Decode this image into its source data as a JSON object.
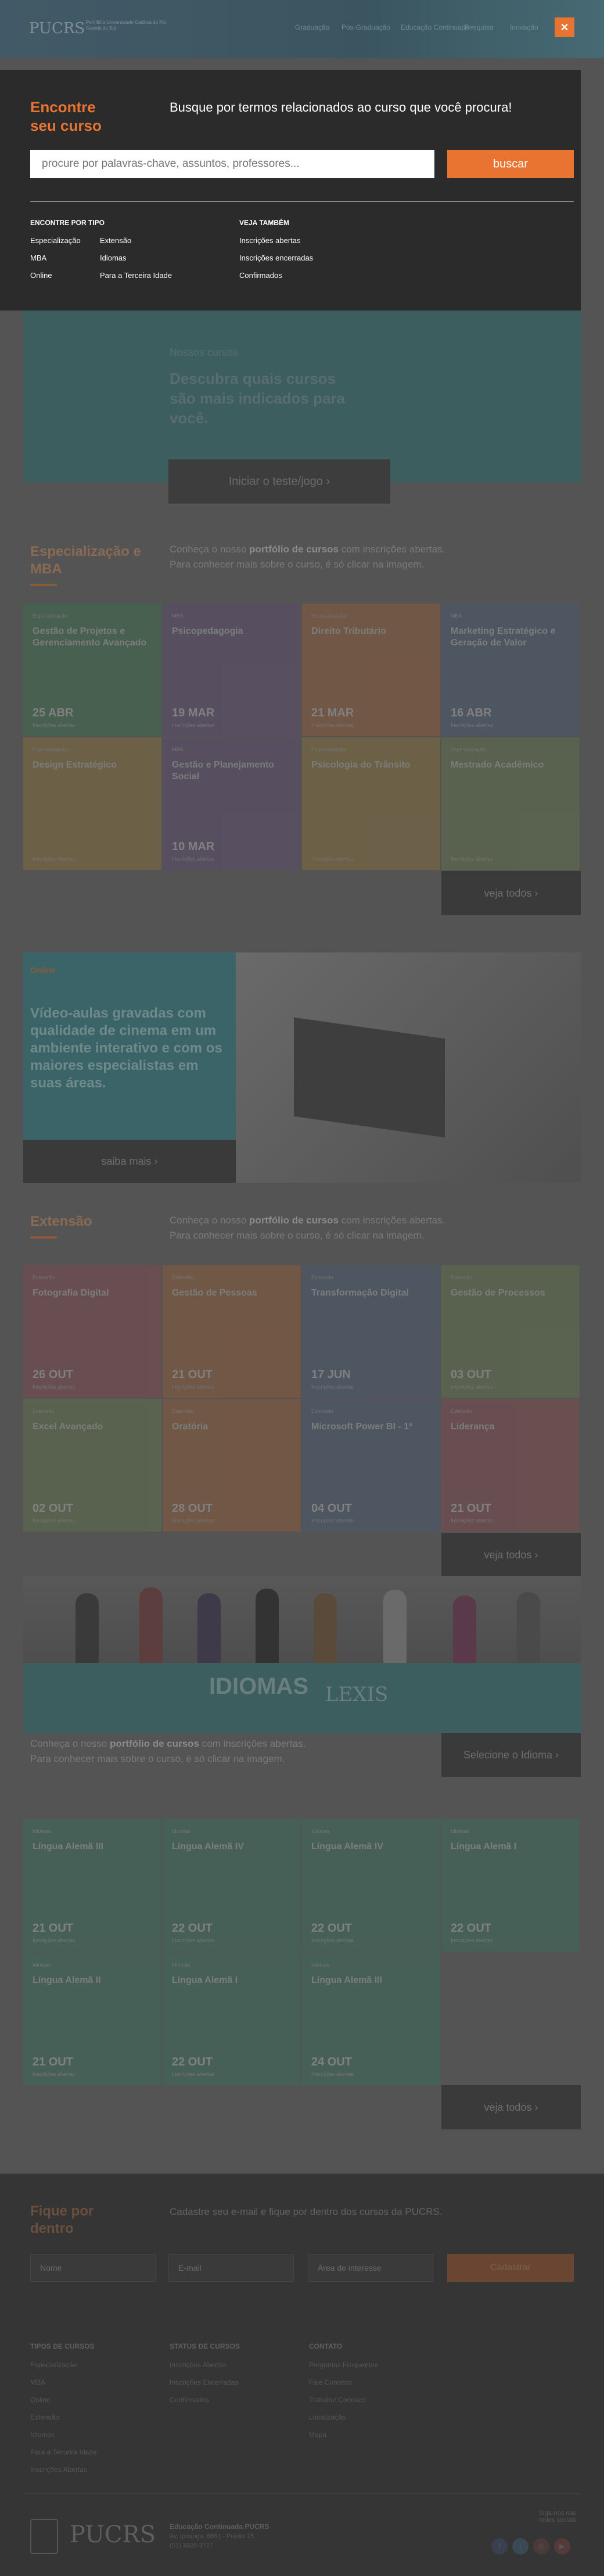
{
  "header": {
    "logo": "PUCRS",
    "logo_sub": "Pontifícia Universidade Católica do Rio Grande do Sul",
    "nav": [
      "Graduação",
      "Pós-Graduação",
      "Educação Continuada",
      "Pesquisa",
      "Inovação"
    ],
    "close_label": "×"
  },
  "search_modal": {
    "title": "Encontre seu curso",
    "subtitle": "Busque por termos relacionados ao curso que você procura!",
    "placeholder": "procure por palavras-chave, assuntos, professores...",
    "button": "buscar",
    "by_type_heading": "ENCONTRE POR TIPO",
    "by_type_col1": [
      "Especialização",
      "MBA",
      "Online"
    ],
    "by_type_col2": [
      "Extensão",
      "Idiomas",
      "Para a Terceira Idade"
    ],
    "see_also_heading": "VEJA TAMBÉM",
    "see_also": [
      "Inscrições abertas",
      "Inscrições encerradas",
      "Confirmados"
    ]
  },
  "hero": {
    "label": "Nossos cursos",
    "title": "Descubra quais cursos são mais indicados para você.",
    "button": "Iniciar o teste/jogo  ›"
  },
  "especializacao": {
    "title": "Especialização e MBA",
    "desc_prefix": "Conheça o nosso ",
    "desc_bold": "portfólio de cursos",
    "desc_suffix": " com inscrições abertas.",
    "desc_line2": "Para conhecer mais sobre o curso, é só clicar na imagem.",
    "cards": [
      {
        "kind": "Especialização",
        "title": "Gestão de Projetos e Gerenciamento Avançado",
        "date": "25 ABR",
        "sub": "Inscrições abertas",
        "color": "#3f6a4d"
      },
      {
        "kind": "MBA",
        "title": "Psicopedagogia",
        "date": "19 MAR",
        "sub": "Inscrições abertas",
        "color": "#5b4a6b"
      },
      {
        "kind": "Especialização",
        "title": "Direito Tributário",
        "date": "21 MAR",
        "sub": "Inscrições abertas",
        "color": "#8a5a3a"
      },
      {
        "kind": "MBA",
        "title": "Marketing Estratégico e Geração de Valor",
        "date": "16 ABR",
        "sub": "Inscrições abertas",
        "color": "#4a586e"
      },
      {
        "kind": "Especialização",
        "title": "Design Estratégico",
        "date": "",
        "sub": "Inscrições abertas",
        "color": "#806a3e"
      },
      {
        "kind": "MBA",
        "title": "Gestão e Planejamento Social",
        "date": "10 MAR",
        "sub": "Inscrições abertas",
        "color": "#5b4a6b"
      },
      {
        "kind": "Especialização",
        "title": "Psicologia do Trânsito",
        "date": "",
        "sub": "Inscrições abertas",
        "color": "#806a3e"
      },
      {
        "kind": "Especialização",
        "title": "Mestrado Acadêmico",
        "date": "",
        "sub": "Inscrições abertas",
        "color": "#5e6f4a"
      }
    ],
    "see_all": "veja todos  ›"
  },
  "video": {
    "label": "Online",
    "text": "Vídeo-aulas gravadas com qualidade de cinema em um ambiente interativo e com os maiores especialistas em suas áreas.",
    "button": "saiba mais  ›"
  },
  "extensao": {
    "title": "Extensão",
    "desc_prefix": "Conheça o nosso ",
    "desc_bold": "portfólio de cursos",
    "desc_suffix": " com inscrições abertas.",
    "desc_line2": "Para conhecer mais sobre o curso, é só clicar na imagem.",
    "cards": [
      {
        "kind": "Extensão",
        "title": "Fotografia Digital",
        "date": "26 OUT",
        "sub": "Inscrições abertas",
        "color": "#7a4a4d"
      },
      {
        "kind": "Extensão",
        "title": "Gestão de Pessoas",
        "date": "21 OUT",
        "sub": "Inscrições abertas",
        "color": "#8a5a3a"
      },
      {
        "kind": "Extensão",
        "title": "Transformação Digital",
        "date": "17 JUN",
        "sub": "Inscrições abertas",
        "color": "#4a586e"
      },
      {
        "kind": "Extensão",
        "title": "Gestão de Processos",
        "date": "03 OUT",
        "sub": "Inscrições abertas",
        "color": "#5e6f4a"
      },
      {
        "kind": "Extensão",
        "title": "Excel Avançado",
        "date": "02 OUT",
        "sub": "Inscrições abertas",
        "color": "#5e6f4a"
      },
      {
        "kind": "Extensão",
        "title": "Oratória",
        "date": "28 OUT",
        "sub": "Inscrições abertas",
        "color": "#8a5a3a"
      },
      {
        "kind": "Extensão",
        "title": "Microsoft Power BI - 1ª",
        "date": "04 OUT",
        "sub": "Inscrições abertas",
        "color": "#4a586e"
      },
      {
        "kind": "Extensão",
        "title": "Liderança",
        "date": "21 OUT",
        "sub": "Inscrições abertas",
        "color": "#7a4a4d"
      }
    ],
    "see_all": "veja todos  ›"
  },
  "idiomas": {
    "logo": "IDIOMAS",
    "partner": "LEXIS",
    "desc_prefix": "Conheça o nosso ",
    "desc_bold": "portfólio de cursos",
    "desc_suffix": " com inscrições abertas.",
    "desc_line2": "Para conhecer mais sobre o curso, é só clicar na imagem.",
    "select_button": "Selecione o Idioma  ›",
    "cards": [
      {
        "kind": "Idiomas",
        "title": "Língua Alemã III",
        "date": "21 OUT",
        "sub": "Inscrições abertas",
        "color": "#3d6a5a"
      },
      {
        "kind": "Idiomas",
        "title": "Língua Alemã IV",
        "date": "22 OUT",
        "sub": "Inscrições abertas",
        "color": "#3d6a5a"
      },
      {
        "kind": "Idiomas",
        "title": "Língua Alemã IV",
        "date": "22 OUT",
        "sub": "Inscrições abertas",
        "color": "#3d6a5a"
      },
      {
        "kind": "Idiomas",
        "title": "Língua Alemã I",
        "date": "22 OUT",
        "sub": "Inscrições abertas",
        "color": "#3d6a5a"
      },
      {
        "kind": "Idiomas",
        "title": "Língua Alemã II",
        "date": "21 OUT",
        "sub": "Inscrições abertas",
        "color": "#3d6a5a"
      },
      {
        "kind": "Idiomas",
        "title": "Língua Alemã I",
        "date": "22 OUT",
        "sub": "Inscrições abertas",
        "color": "#3d6a5a"
      },
      {
        "kind": "Idiomas",
        "title": "Língua Alemã III",
        "date": "24 OUT",
        "sub": "Inscrições abertas",
        "color": "#3d6a5a"
      }
    ],
    "see_all": "veja todos  ›"
  },
  "footer": {
    "title": "Fique por dentro",
    "desc": "Cadastre seu e-mail e fique por dentro dos cursos da PUCRS.",
    "name_placeholder": "Nome",
    "email_placeholder": "E-mail",
    "area_placeholder": "Área de interesse",
    "submit": "Cadastrar",
    "col1_heading": "TIPOS DE CURSOS",
    "col1": [
      "Especialização",
      "MBA",
      "Online",
      "Extensão",
      "Idiomas",
      "Para a Terceira Idade",
      "Inscrições Abertas"
    ],
    "col2_heading": "STATUS DE CURSOS",
    "col2": [
      "Inscrições Abertas",
      "Inscrições Encerradas",
      "Confirmados"
    ],
    "col3_heading": "CONTATO",
    "col3": [
      "Perguntas Frequentes",
      "Fale Conosco",
      "Trabalhe Conosco",
      "Localização",
      "Mapa"
    ],
    "logo": "PUCRS",
    "address_title": "Educação Continuada PUCRS",
    "address": "Av. Ipiranga, 6681 - Prédio 15",
    "phone": "(51) 3320-3727",
    "follow": "Siga-nos nas redes sociais"
  }
}
